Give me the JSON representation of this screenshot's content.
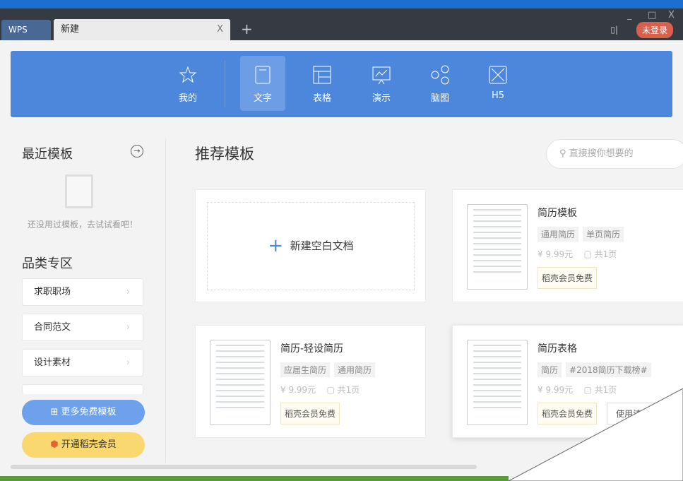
{
  "window": {
    "controls": [
      "_",
      "□",
      "X"
    ],
    "tabs": [
      {
        "label": "WPS"
      },
      {
        "label": "新建"
      }
    ],
    "add_tab": "+",
    "close": "X",
    "login": "未登录"
  },
  "nav": [
    {
      "label": "我的",
      "icon": "star-icon"
    },
    {
      "label": "文字",
      "icon": "document-icon",
      "active": true
    },
    {
      "label": "表格",
      "icon": "table-icon"
    },
    {
      "label": "演示",
      "icon": "presentation-icon"
    },
    {
      "label": "脑图",
      "icon": "mindmap-icon"
    },
    {
      "label": "H5",
      "icon": "h5-icon"
    }
  ],
  "sidebar": {
    "recent_title": "最近模板",
    "empty_text": "还没用过模板，去试试看吧！",
    "category_title": "品类专区",
    "categories": [
      "求职职场",
      "合同范文",
      "设计素材"
    ],
    "more_button": "更多免费模板",
    "vip_button": "开通稻壳会员"
  },
  "main": {
    "title": "推荐模板",
    "search_placeholder": "直接搜你想要的",
    "new_blank": "新建空白文档",
    "templates": [
      {
        "title": "简历模板",
        "tags": [
          "通用简历",
          "单页简历"
        ],
        "price": "9.99元",
        "pages": "共1页",
        "free_label": "稻壳会员免费"
      },
      {
        "title": "简历-轻设简历",
        "tags": [
          "应届生简历",
          "通用简历"
        ],
        "price": "9.99元",
        "pages": "共1页",
        "free_label": "稻壳会员免费"
      },
      {
        "title": "简历表格",
        "tags": [
          "简历",
          "#2018简历下载榜#"
        ],
        "price": "9.99元",
        "pages": "共1页",
        "free_label": "稻壳会员免费",
        "use_label": "使用该模板"
      }
    ]
  },
  "colors": {
    "banner": "#4d87dc",
    "login": "#d8604c",
    "more": "#6ea1ec",
    "vip": "#f8d86f"
  }
}
